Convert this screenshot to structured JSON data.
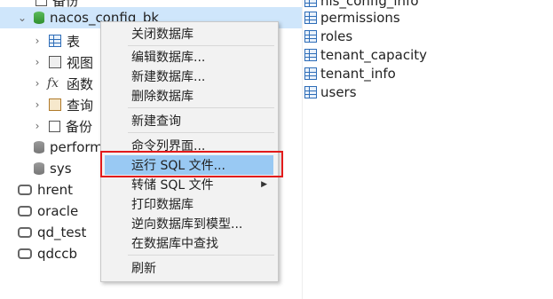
{
  "tree": {
    "partial_top": "备份",
    "selected_db": "nacos_config_bk",
    "children": [
      {
        "label": "表",
        "icon": "table-icon"
      },
      {
        "label": "视图",
        "icon": "view-icon"
      },
      {
        "label": "函数",
        "icon": "function-icon"
      },
      {
        "label": "查询",
        "icon": "query-icon"
      },
      {
        "label": "备份",
        "icon": "backup-icon"
      }
    ],
    "databases": [
      "perform",
      "sys"
    ],
    "connections": [
      "hrent",
      "oracle",
      "qd_test",
      "qdccb"
    ]
  },
  "right_panel": {
    "partial_top": "his_config_info",
    "tables": [
      "permissions",
      "roles",
      "tenant_capacity",
      "tenant_info",
      "users"
    ]
  },
  "context_menu": {
    "items": [
      {
        "label": "关闭数据库"
      },
      {
        "label": "编辑数据库..."
      },
      {
        "label": "新建数据库..."
      },
      {
        "label": "删除数据库"
      },
      {
        "label": "新建查询"
      },
      {
        "label": "命令列界面..."
      },
      {
        "label": "运行 SQL 文件...",
        "highlighted": true
      },
      {
        "label": "转储 SQL 文件",
        "submenu": true
      },
      {
        "label": "打印数据库"
      },
      {
        "label": "逆向数据库到模型..."
      },
      {
        "label": "在数据库中查找"
      },
      {
        "label": "刷新"
      }
    ]
  },
  "colors": {
    "highlight": "#99c9f3",
    "selection": "#cfe6fb",
    "annotation": "#e21b1b"
  }
}
